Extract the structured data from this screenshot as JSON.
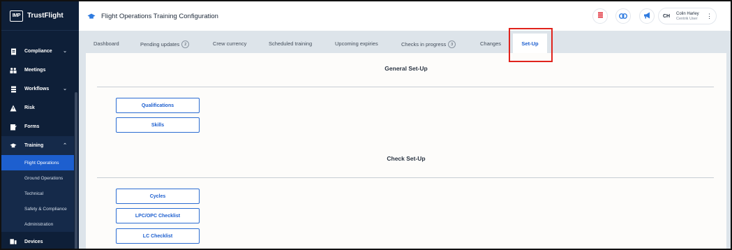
{
  "brand": {
    "logo_text": "IMP",
    "name": "TrustFlight"
  },
  "sidebar": {
    "items": [
      {
        "label": "Compliance",
        "icon": "document-icon",
        "has_chevron": true,
        "chevron": "⌄"
      },
      {
        "label": "Meetings",
        "icon": "people-icon"
      },
      {
        "label": "Workflows",
        "icon": "workflow-icon",
        "has_chevron": true,
        "chevron": "⌄"
      },
      {
        "label": "Risk",
        "icon": "warning-icon"
      },
      {
        "label": "Forms",
        "icon": "form-icon"
      },
      {
        "label": "Training",
        "icon": "graduation-cap-icon",
        "has_chevron": true,
        "chevron": "⌃",
        "expanded": true
      }
    ],
    "subitems": [
      {
        "label": "Flight Operations",
        "active": true
      },
      {
        "label": "Ground Operations"
      },
      {
        "label": "Technical"
      },
      {
        "label": "Safety & Compliance"
      },
      {
        "label": "Administration"
      }
    ],
    "bottom_item": {
      "label": "Devices",
      "icon": "devices-icon"
    }
  },
  "header": {
    "title": "Flight Operations Training Configuration",
    "user": {
      "initials": "CH",
      "name": "Colin Harley",
      "role": "Centrik User",
      "menu_glyph": "⋮"
    }
  },
  "tabs": [
    {
      "label": "Dashboard"
    },
    {
      "label": "Pending updates",
      "badge": "2"
    },
    {
      "label": "Crew currency"
    },
    {
      "label": "Scheduled training"
    },
    {
      "label": "Upcoming expiries"
    },
    {
      "label": "Checks in progress",
      "badge": "3"
    },
    {
      "label": "Changes"
    },
    {
      "label": "Set-Up",
      "active": true
    }
  ],
  "general_setup": {
    "title": "General Set-Up",
    "buttons": [
      "Qualifications",
      "Skills"
    ]
  },
  "check_setup": {
    "title": "Check Set-Up",
    "buttons": [
      "Cycles",
      "LPC/OPC Checklist",
      "LC Checklist"
    ]
  },
  "colors": {
    "sidebar_bg": "#0e1f38",
    "active_blue": "#1d5fcf",
    "highlight_red": "#e0231c"
  }
}
